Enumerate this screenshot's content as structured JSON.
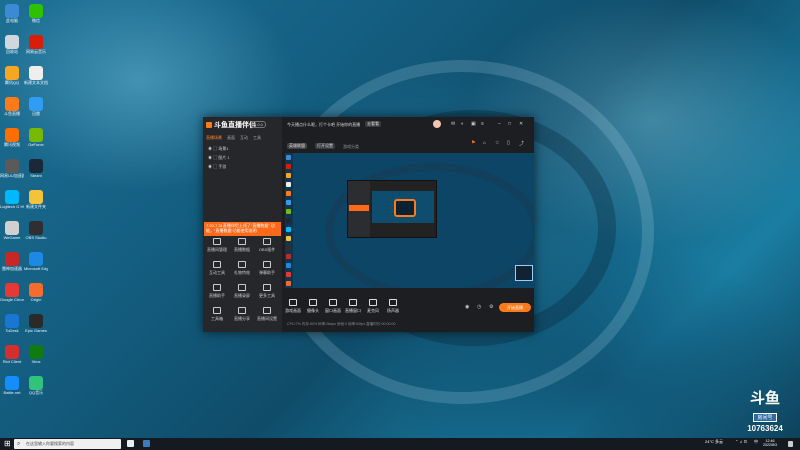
{
  "desktop": {
    "icons": [
      {
        "label": "此电脑",
        "color": "#3c8ad6"
      },
      {
        "label": "微信",
        "color": "#2dc100"
      },
      {
        "label": "回收站",
        "color": "#cfd8dc"
      },
      {
        "label": "网易云音乐",
        "color": "#d81e06"
      },
      {
        "label": "腾讯QQ",
        "color": "#f5a623"
      },
      {
        "label": "新建文本文档",
        "color": "#eeeeee"
      },
      {
        "label": "斗鱼直播",
        "color": "#ff7a1a"
      },
      {
        "label": "迅雷",
        "color": "#2f9df4"
      },
      {
        "label": "腾讯视频",
        "color": "#ff6f00"
      },
      {
        "label": "GeForce",
        "color": "#76b900"
      },
      {
        "label": "网易UU加速器",
        "color": "#5a5a5a"
      },
      {
        "label": "Steam",
        "color": "#1b2838"
      },
      {
        "label": "Logitech G HUB",
        "color": "#00b8fc"
      },
      {
        "label": "新建文件夹",
        "color": "#f3c33c"
      },
      {
        "label": "WeGame",
        "color": "#d0d0d0"
      },
      {
        "label": "OBS Studio",
        "color": "#302e31"
      },
      {
        "label": "雷神加速器",
        "color": "#c62828"
      },
      {
        "label": "Microsoft Edge",
        "color": "#1e88e5"
      },
      {
        "label": "Google Chrome",
        "color": "#e53935"
      },
      {
        "label": "Origin",
        "color": "#f56c2d"
      },
      {
        "label": "ToDesk",
        "color": "#1976d2"
      },
      {
        "label": "Epic Games",
        "color": "#2a2a2a"
      },
      {
        "label": "Riot Client",
        "color": "#d32f2f"
      },
      {
        "label": "Xbox",
        "color": "#107c10"
      },
      {
        "label": "Battle.net",
        "color": "#148eff"
      },
      {
        "label": "QQ音乐",
        "color": "#31c27c"
      }
    ]
  },
  "app": {
    "title": "斗鱼直播伴侣",
    "version": "5.0.0",
    "tabs": [
      "直播场景",
      "画面",
      "互动",
      "工具"
    ],
    "scenes": [
      "场景1",
      "图片 1",
      "手游"
    ],
    "notice": "今天播点什么呢，打个卡吧 开始你的直播",
    "notice_button": "去看看",
    "category_button": "英雄联盟",
    "category_button2": "打开设置",
    "sub_label": "游戏分类",
    "promo_text": "7.20-7.31直播伴侣上线了“直播数据” 功能，“直播数据”功能使用说明",
    "tools": [
      {
        "label": "直播间管理"
      },
      {
        "label": "直播数据"
      },
      {
        "label": "OBS插件"
      },
      {
        "label": "互动工具"
      },
      {
        "label": "礼物特效"
      },
      {
        "label": "弹幕助手"
      },
      {
        "label": "直播助手"
      },
      {
        "label": "直播录屏"
      },
      {
        "label": "更多工具"
      },
      {
        "label": "工具箱"
      },
      {
        "label": "直播分享"
      },
      {
        "label": "直播间设置"
      }
    ],
    "bottom_tools": [
      {
        "label": "游戏画面"
      },
      {
        "label": "摄像头"
      },
      {
        "label": "窗口画面"
      },
      {
        "label": "直播窗口"
      },
      {
        "label": "麦克风"
      },
      {
        "label": "扬声器"
      }
    ],
    "live_button": "开始直播",
    "status_text": "CPU:7% 内存:50% 码率:0kbps 丢帧:0 帧率:60fps 直播时长:00:00:00",
    "window_controls": [
      "–",
      "□",
      "✕"
    ]
  },
  "taskbar": {
    "search_placeholder": "在这里输入你要搜索的内容",
    "weather": "24°C 多云",
    "lang": "中",
    "time": "12:46",
    "date": "2022/8/3"
  },
  "watermark": {
    "brand": "斗鱼",
    "room_label": "房间号",
    "room_number": "10763624"
  }
}
